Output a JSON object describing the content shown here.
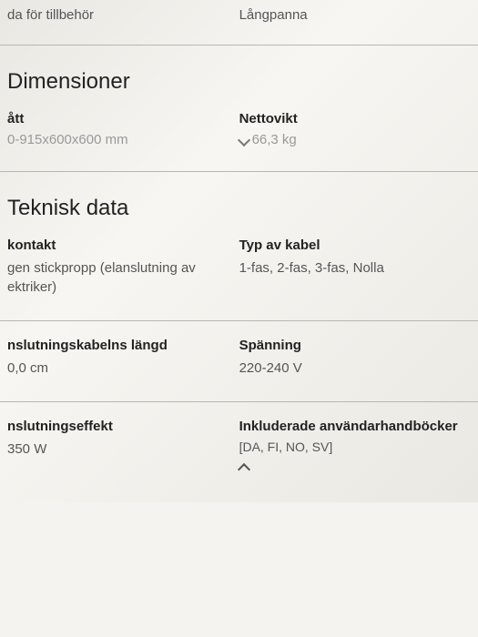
{
  "topPartial": {
    "leftLabel": "da för tillbehör",
    "rightValue": "Långpanna"
  },
  "dimensions": {
    "header": "Dimensioner",
    "leftLabel": "ått",
    "leftValue": "0-915x600x600 mm",
    "rightLabel": "Nettovikt",
    "rightValue": "66,3 kg"
  },
  "technical": {
    "header": "Teknisk data",
    "row1": {
      "leftLabel": "kontakt",
      "leftValue": "gen stickpropp (elanslutning av ektriker)",
      "rightLabel": "Typ av kabel",
      "rightValue": "1-fas, 2-fas, 3-fas, Nolla"
    },
    "row2": {
      "leftLabel": "nslutningskabelns längd",
      "leftValue": "0,0 cm",
      "rightLabel": "Spänning",
      "rightValue": "220-240 V"
    },
    "row3": {
      "leftLabel": "nslutningseffekt",
      "leftValue": "350 W",
      "rightLabel": "Inkluderade användarhandböcker",
      "rightValue": "[DA, FI, NO, SV]"
    }
  }
}
